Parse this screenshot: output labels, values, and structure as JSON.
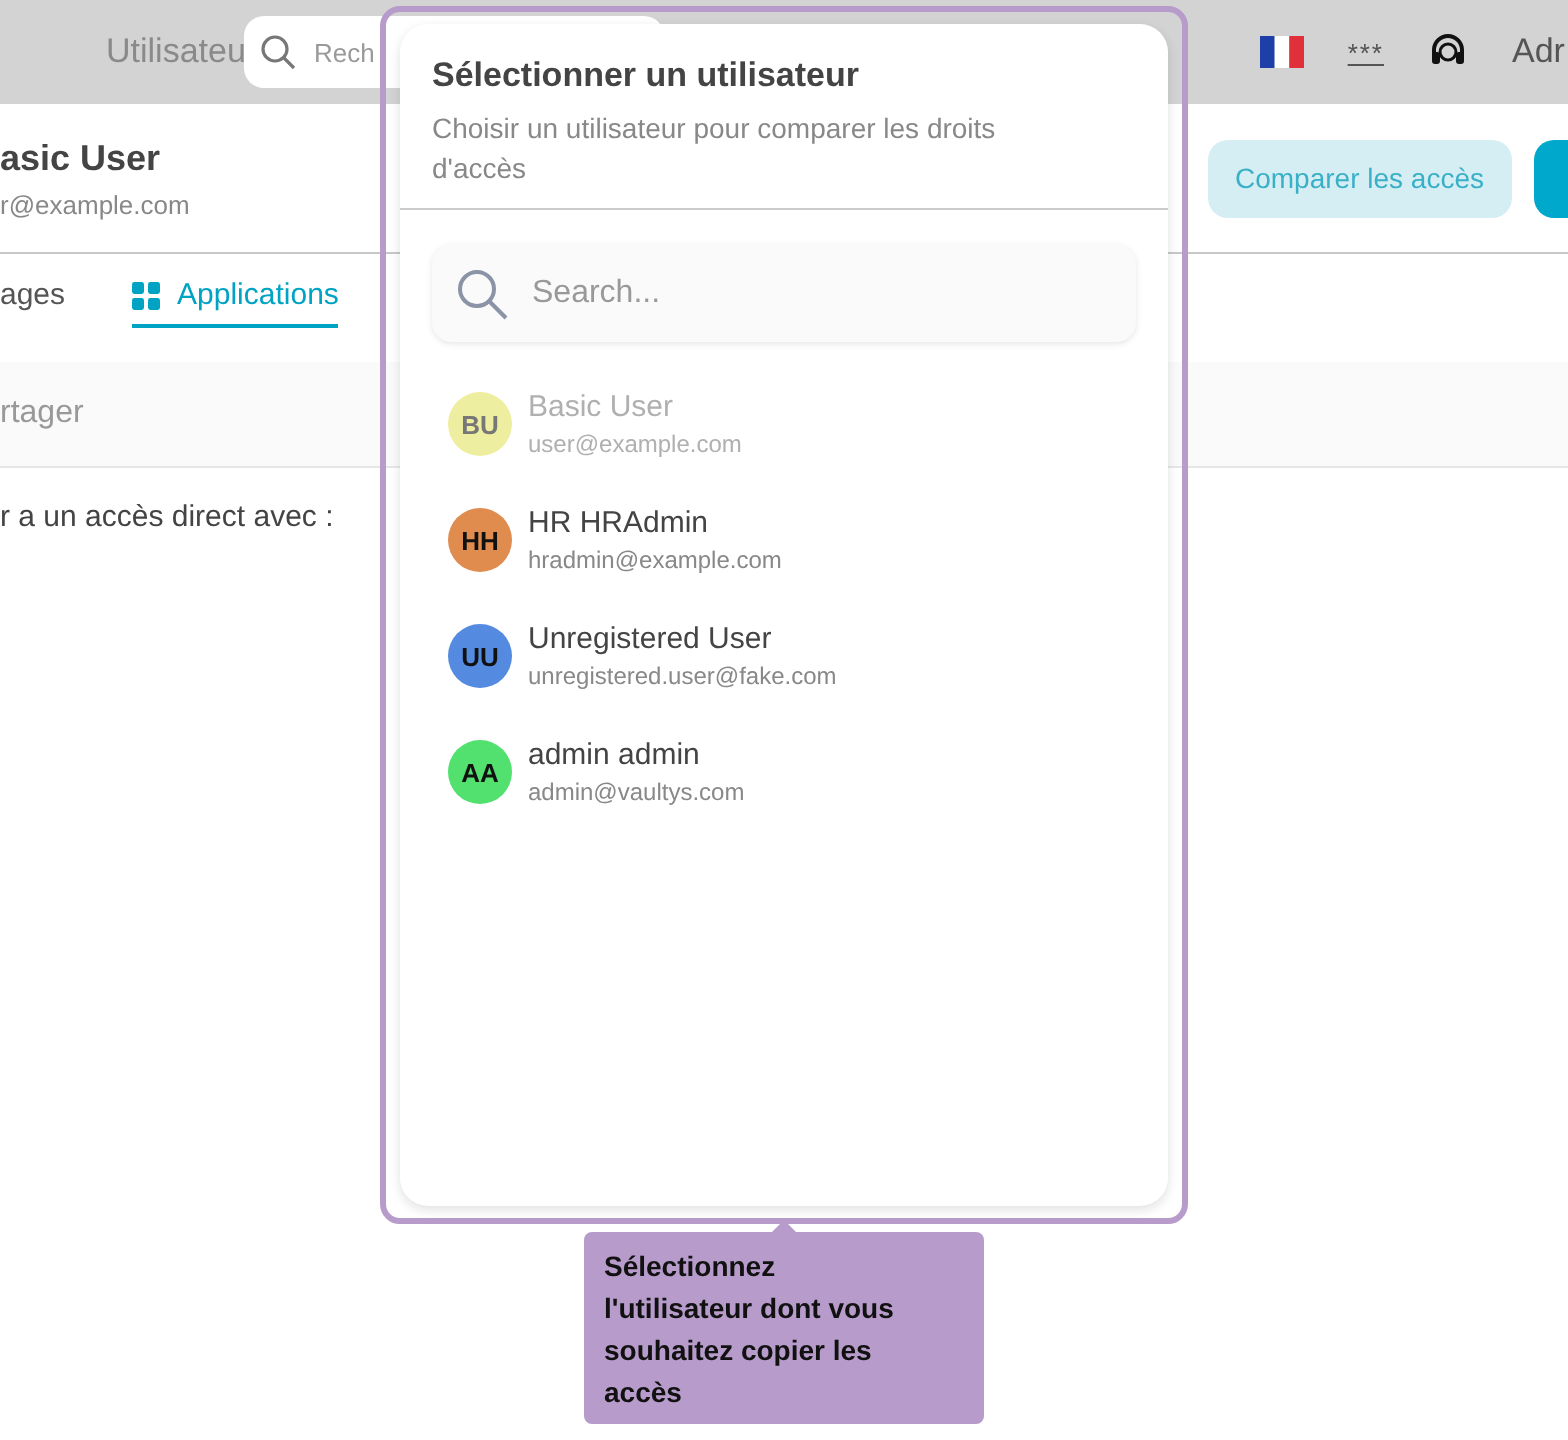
{
  "topbar": {
    "title": "Utilisateu",
    "search": {
      "placeholder": "Rech"
    },
    "masked": "***",
    "account": "Adr"
  },
  "header": {
    "name": "asic User",
    "email": "r@example.com",
    "compare_button": "Comparer les accès"
  },
  "tabs": [
    {
      "label": "ages",
      "selected": false
    },
    {
      "label": "Applications",
      "selected": true
    }
  ],
  "section": {
    "label": "rtager"
  },
  "body_text": "r a un accès direct avec :",
  "dialog": {
    "title": "Sélectionner un utilisateur",
    "subtitle": "Choisir un utilisateur pour comparer les droits d'accès",
    "search": {
      "placeholder": "Search..."
    },
    "users": [
      {
        "initials": "BU",
        "name": "Basic User",
        "email": "user@example.com",
        "color": "#eeeea0",
        "disabled": true
      },
      {
        "initials": "HH",
        "name": "HR HRAdmin",
        "email": "hradmin@example.com",
        "color": "#e08c4e",
        "disabled": false
      },
      {
        "initials": "UU",
        "name": "Unregistered User",
        "email": "unregistered.user@fake.com",
        "color": "#548ae0",
        "disabled": false
      },
      {
        "initials": "AA",
        "name": "admin admin",
        "email": "admin@vaultys.com",
        "color": "#52e06e",
        "disabled": false
      }
    ]
  },
  "tooltip": {
    "text": "Sélectionnez l'utilisateur dont vous souhaitez copier les accès"
  }
}
